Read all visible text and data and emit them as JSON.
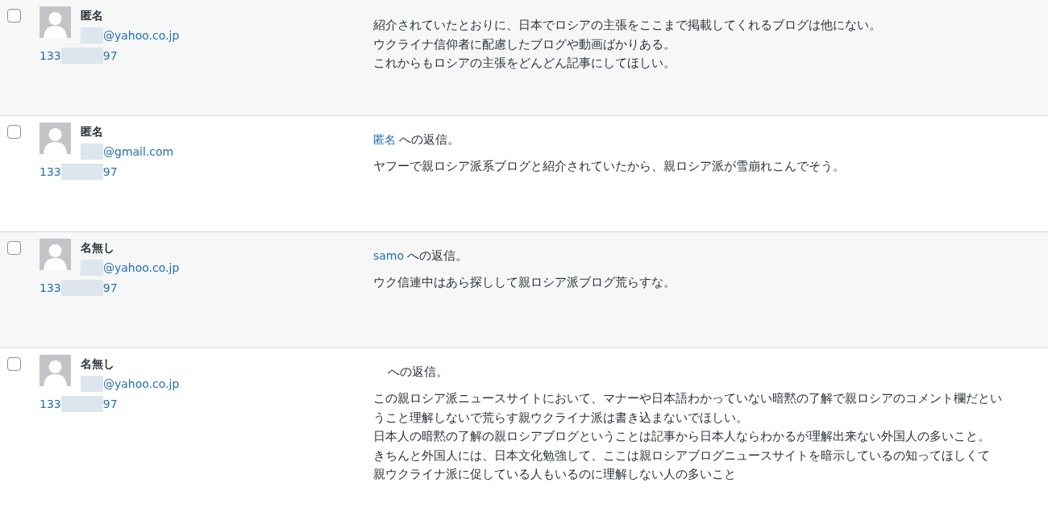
{
  "comments": [
    {
      "selected": false,
      "author": "匿名",
      "email": "@yahoo.co.jp",
      "ip_start": "133",
      "ip_end": "97",
      "body": [
        "紹介されていたとおりに、日本でロシアの主張をここまで掲載してくれるブログは他にない。",
        "ウクライナ信仰者に配慮したブログや動画ばかりある。",
        "これからもロシアの主張をどんどん記事にしてほしい。"
      ]
    },
    {
      "selected": false,
      "author": "匿名",
      "email": "@gmail.com",
      "ip_start": "133",
      "ip_end": "97",
      "reply_to": {
        "author": "匿名",
        "text": "への返信。"
      },
      "body": [
        "ヤフーで親ロシア派系ブログと紹介されていたから、親ロシア派が雪崩れこんでそう。"
      ]
    },
    {
      "selected": false,
      "author": "名無し",
      "email": "@yahoo.co.jp",
      "ip_start": "133",
      "ip_end": "97",
      "reply_to": {
        "author": "samo",
        "text": "への返信。"
      },
      "body": [
        "ウク信連中はあら探しして親ロシア派ブログ荒らすな。"
      ]
    },
    {
      "selected": false,
      "author": "名無し",
      "email": "@yahoo.co.jp",
      "ip_start": "133",
      "ip_end": "97",
      "reply_to": {
        "text": "への返信。"
      },
      "body": [
        "この親ロシア派ニュースサイトにおいて、マナーや日本語わかっていない暗黙の了解で親ロシアのコメント欄だということ理解しないで荒らす親ウクライナ派は書き込まないでほしい。",
        "日本人の暗黙の了解の親ロシアブログということは記事から日本人ならわかるが理解出来ない外国人の多いこと。",
        "きちんと外国人には、日本文化勉強して、ここは親ロシアブログニュースサイトを暗示しているの知ってほしくて",
        "親ウクライナ派に促している人もいるのに理解しない人の多いこと"
      ]
    }
  ]
}
